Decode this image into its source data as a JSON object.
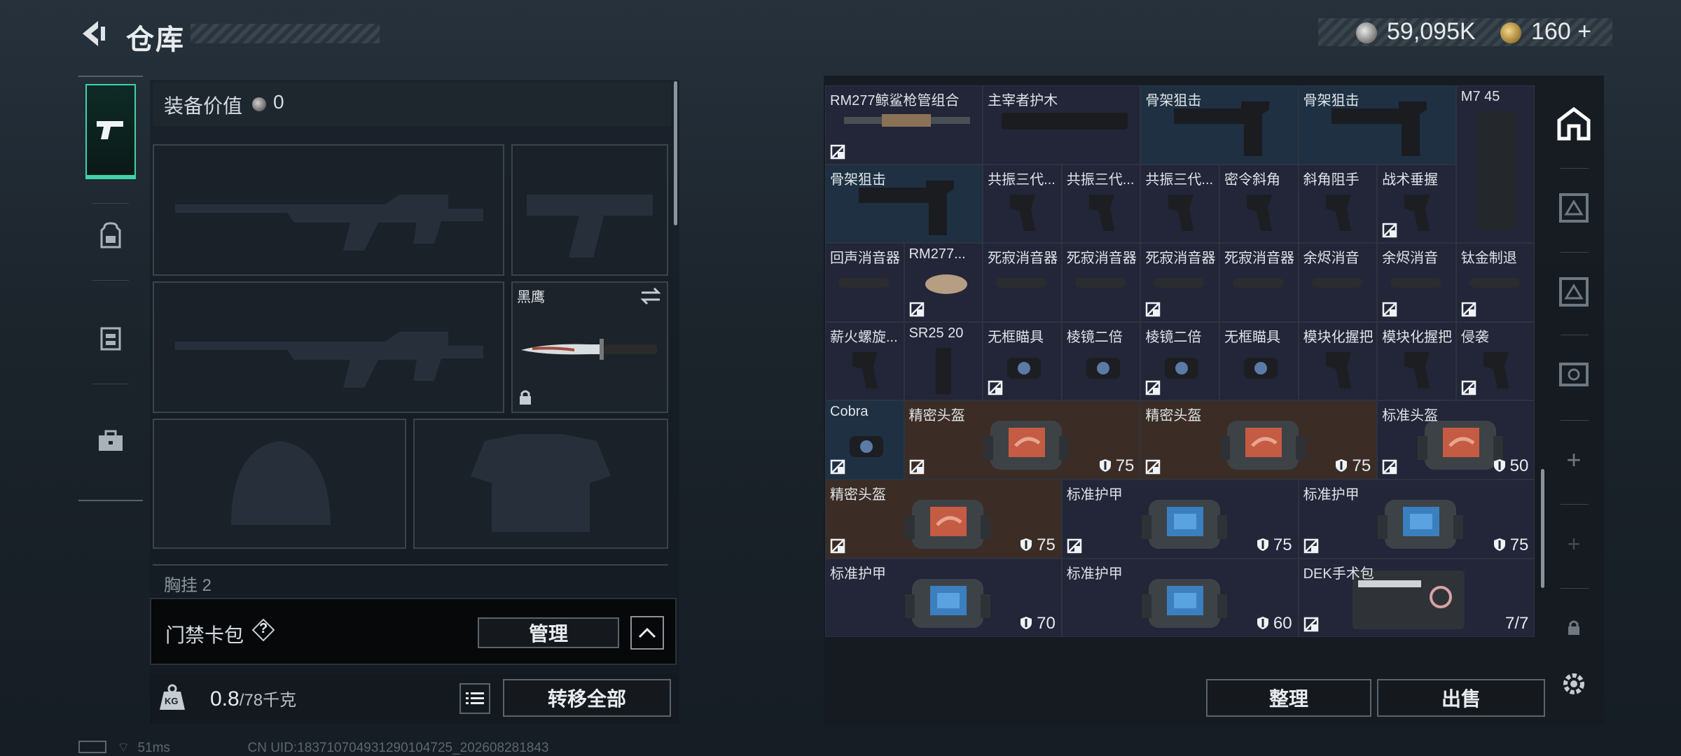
{
  "header": {
    "title": "仓库"
  },
  "currency": {
    "silver": "59,095K",
    "gold": "160",
    "gold_add": "+"
  },
  "equipment": {
    "label": "装备价值",
    "value": "0"
  },
  "slots": {
    "knife_name": "黑鹰",
    "chest_label": "胸挂",
    "chest_value": "2"
  },
  "card_pack": {
    "label": "门禁卡包",
    "help": "?",
    "manage": "管理"
  },
  "weight": {
    "current": "0.8",
    "unit": "/78千克",
    "kg_icon": "KG",
    "transfer_all": "转移全部"
  },
  "footer": {
    "ping": "51ms",
    "uid": "CN UID:183710704931290104725_202608281843"
  },
  "stash": {
    "items": [
      {
        "name": "RM277鲸鲨枪管组合",
        "locked": true,
        "tone": "dark"
      },
      {
        "name": "主宰者护木",
        "locked": false,
        "tone": "dark"
      },
      {
        "name": "骨架狙击",
        "locked": false,
        "tone": "blue"
      },
      {
        "name": "骨架狙击",
        "locked": false,
        "tone": "blue"
      },
      {
        "name": "M7 45",
        "locked": false,
        "tone": "dark"
      },
      {
        "name": "骨架狙击",
        "locked": false,
        "tone": "blue"
      },
      {
        "name": "共振三代...",
        "locked": false,
        "tone": "dark"
      },
      {
        "name": "共振三代...",
        "locked": false,
        "tone": "dark"
      },
      {
        "name": "共振三代...",
        "locked": false,
        "tone": "dark"
      },
      {
        "name": "密令斜角",
        "locked": false,
        "tone": "dark"
      },
      {
        "name": "斜角阻手",
        "locked": false,
        "tone": "dark"
      },
      {
        "name": "战术垂握",
        "locked": true,
        "tone": "dark"
      },
      {
        "name": "回声消音器",
        "locked": false,
        "tone": "dark"
      },
      {
        "name": "RM277...",
        "locked": true,
        "tone": "dark"
      },
      {
        "name": "死寂消音器",
        "locked": false,
        "tone": "dark"
      },
      {
        "name": "死寂消音器",
        "locked": false,
        "tone": "dark"
      },
      {
        "name": "死寂消音器",
        "locked": true,
        "tone": "dark"
      },
      {
        "name": "死寂消音器",
        "locked": false,
        "tone": "dark"
      },
      {
        "name": "余烬消音",
        "locked": false,
        "tone": "dark"
      },
      {
        "name": "余烬消音",
        "locked": true,
        "tone": "dark"
      },
      {
        "name": "钛金制退",
        "locked": true,
        "tone": "dark"
      },
      {
        "name": "薪火螺旋...",
        "locked": false,
        "tone": "dark"
      },
      {
        "name": "SR25 20",
        "locked": false,
        "tone": "dark"
      },
      {
        "name": "无框瞄具",
        "locked": true,
        "tone": "dark"
      },
      {
        "name": "棱镜二倍",
        "locked": false,
        "tone": "dark"
      },
      {
        "name": "棱镜二倍",
        "locked": true,
        "tone": "dark"
      },
      {
        "name": "无框瞄具",
        "locked": false,
        "tone": "dark"
      },
      {
        "name": "模块化握把",
        "locked": false,
        "tone": "dark"
      },
      {
        "name": "模块化握把",
        "locked": false,
        "tone": "dark"
      },
      {
        "name": "侵袭",
        "locked": true,
        "tone": "dark"
      },
      {
        "name": "Cobra",
        "locked": true,
        "tone": "blue"
      },
      {
        "name": "精密头盔",
        "locked": true,
        "tone": "brown",
        "durability": "75"
      },
      {
        "name": "精密头盔",
        "locked": true,
        "tone": "brown",
        "durability": "75"
      },
      {
        "name": "标准头盔",
        "locked": true,
        "tone": "dark",
        "durability": "50"
      },
      {
        "name": "精密头盔",
        "locked": true,
        "tone": "brown",
        "durability": "75"
      },
      {
        "name": "标准护甲",
        "locked": true,
        "tone": "dark",
        "durability": "75"
      },
      {
        "name": "标准护甲",
        "locked": true,
        "tone": "dark",
        "durability": "75"
      },
      {
        "name": "标准护甲",
        "locked": false,
        "tone": "dark",
        "durability": "70"
      },
      {
        "name": "标准护甲",
        "locked": false,
        "tone": "dark",
        "durability": "60"
      },
      {
        "name": "DEK手术包",
        "locked": true,
        "tone": "dark",
        "count": "7/7"
      }
    ],
    "sort": "整理",
    "sell": "出售"
  },
  "colors": {
    "accent": "#3fd3a8",
    "cell": "#232538",
    "cell_blue": "#1e3042",
    "cell_brown": "#3b2d26"
  }
}
